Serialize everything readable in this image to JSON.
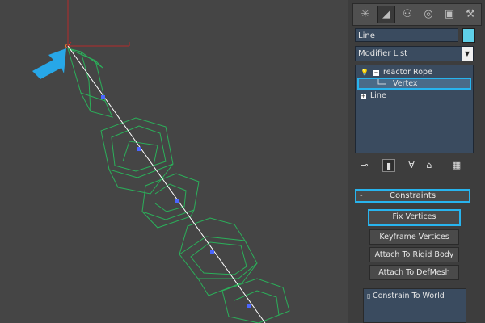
{
  "viewport": {
    "wire_color": "#2bb05a",
    "rope_color": "#ffffff",
    "axis_color": "#b52a2a",
    "vertex_color": "#4b66ff",
    "arrow_color": "#27a7e8"
  },
  "panel": {
    "tabs": [
      {
        "name": "create-tab",
        "glyph": "✳"
      },
      {
        "name": "modify-tab",
        "glyph": "◢"
      },
      {
        "name": "hierarchy-tab",
        "glyph": "⚇"
      },
      {
        "name": "motion-tab",
        "glyph": "◎"
      },
      {
        "name": "display-tab",
        "glyph": "▣"
      },
      {
        "name": "utilities-tab",
        "glyph": "⚒"
      }
    ],
    "object_name": "Line",
    "object_color": "#5fd0e8",
    "modifier_list_label": "Modifier List",
    "stack": {
      "modifier": "reactor Rope",
      "sub_object": "Vertex",
      "base_object": "Line"
    },
    "stack_tools": [
      "pin-stack",
      "show-end-result",
      "make-unique",
      "remove-modifier",
      "configure-sets"
    ],
    "constraints": {
      "title": "Constraints",
      "collapse_glyph": "-",
      "buttons": {
        "fix_vertices": "Fix Vertices",
        "keyframe_vertices": "Keyframe Vertices",
        "attach_rigid_body": "Attach To Rigid Body",
        "attach_defmesh": "Attach To DefMesh"
      },
      "list_item": "Constrain To World"
    }
  }
}
